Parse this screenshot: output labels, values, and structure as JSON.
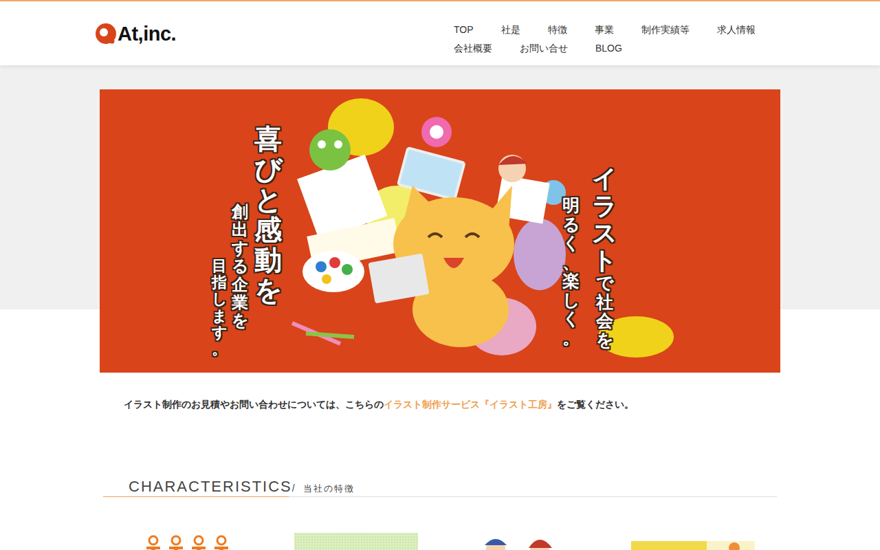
{
  "header": {
    "logo": "At,inc.",
    "nav_rows": [
      [
        "TOP",
        "社是",
        "特徴",
        "事業",
        "制作実績等",
        "求人情報"
      ],
      [
        "会社概要",
        "お問い合せ",
        "BLOG"
      ]
    ]
  },
  "hero": {
    "slogan": [
      "喜びと感動を",
      "創出する企業を",
      "目指します。"
    ],
    "tagline": [
      [
        "イラスト",
        "で社会を"
      ],
      [
        "明るく、楽しく。"
      ]
    ]
  },
  "intro": {
    "before": "イラスト制作のお見積やお問い合わせについては、こちらの",
    "link": "イラスト制作サービス『イラスト工房』",
    "after": "をご覧ください。"
  },
  "characteristics": {
    "title": "CHARACTERISTICS",
    "separator": "/",
    "subtitle": "当社の特徴",
    "cards": [
      {
        "kind": "figures"
      },
      {
        "kind": "pattern"
      },
      {
        "kind": "heads"
      },
      {
        "kind": "banner"
      }
    ]
  }
}
